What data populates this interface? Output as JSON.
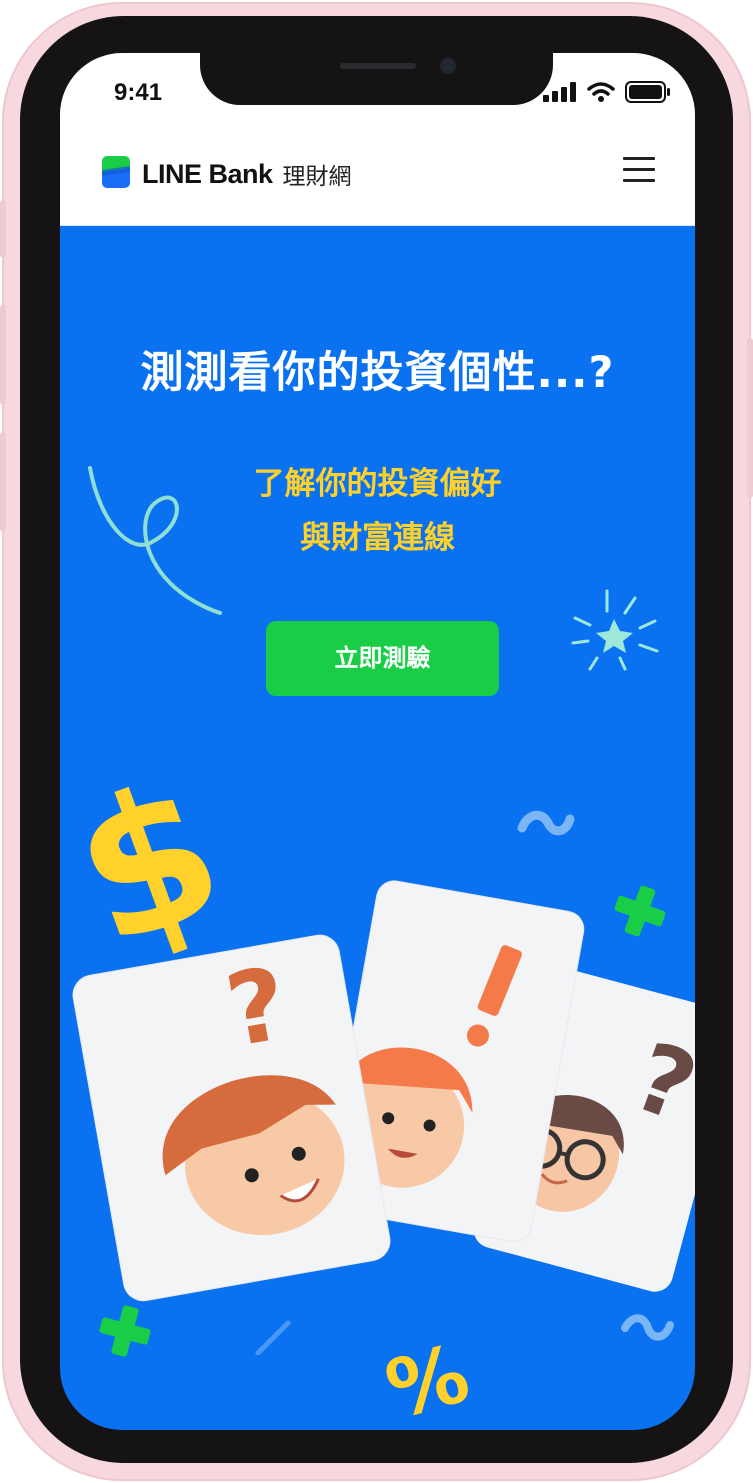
{
  "status_bar": {
    "time": "9:41"
  },
  "header": {
    "brand": "LINE Bank",
    "brand_sub": "理財網"
  },
  "hero": {
    "title": "測測看你的投資個性...?",
    "subtitle_line1": "了解你的投資偏好",
    "subtitle_line2": "與財富連線",
    "cta_label": "立即測驗"
  },
  "colors": {
    "background": "#0a72f0",
    "title": "#ffffff",
    "subtitle": "#ffd12a",
    "cta": "#19cd47",
    "frame": "#f6d8de"
  },
  "icons": [
    "signal-icon",
    "wifi-icon",
    "battery-icon",
    "line-bank-logo-icon",
    "hamburger-menu-icon"
  ]
}
